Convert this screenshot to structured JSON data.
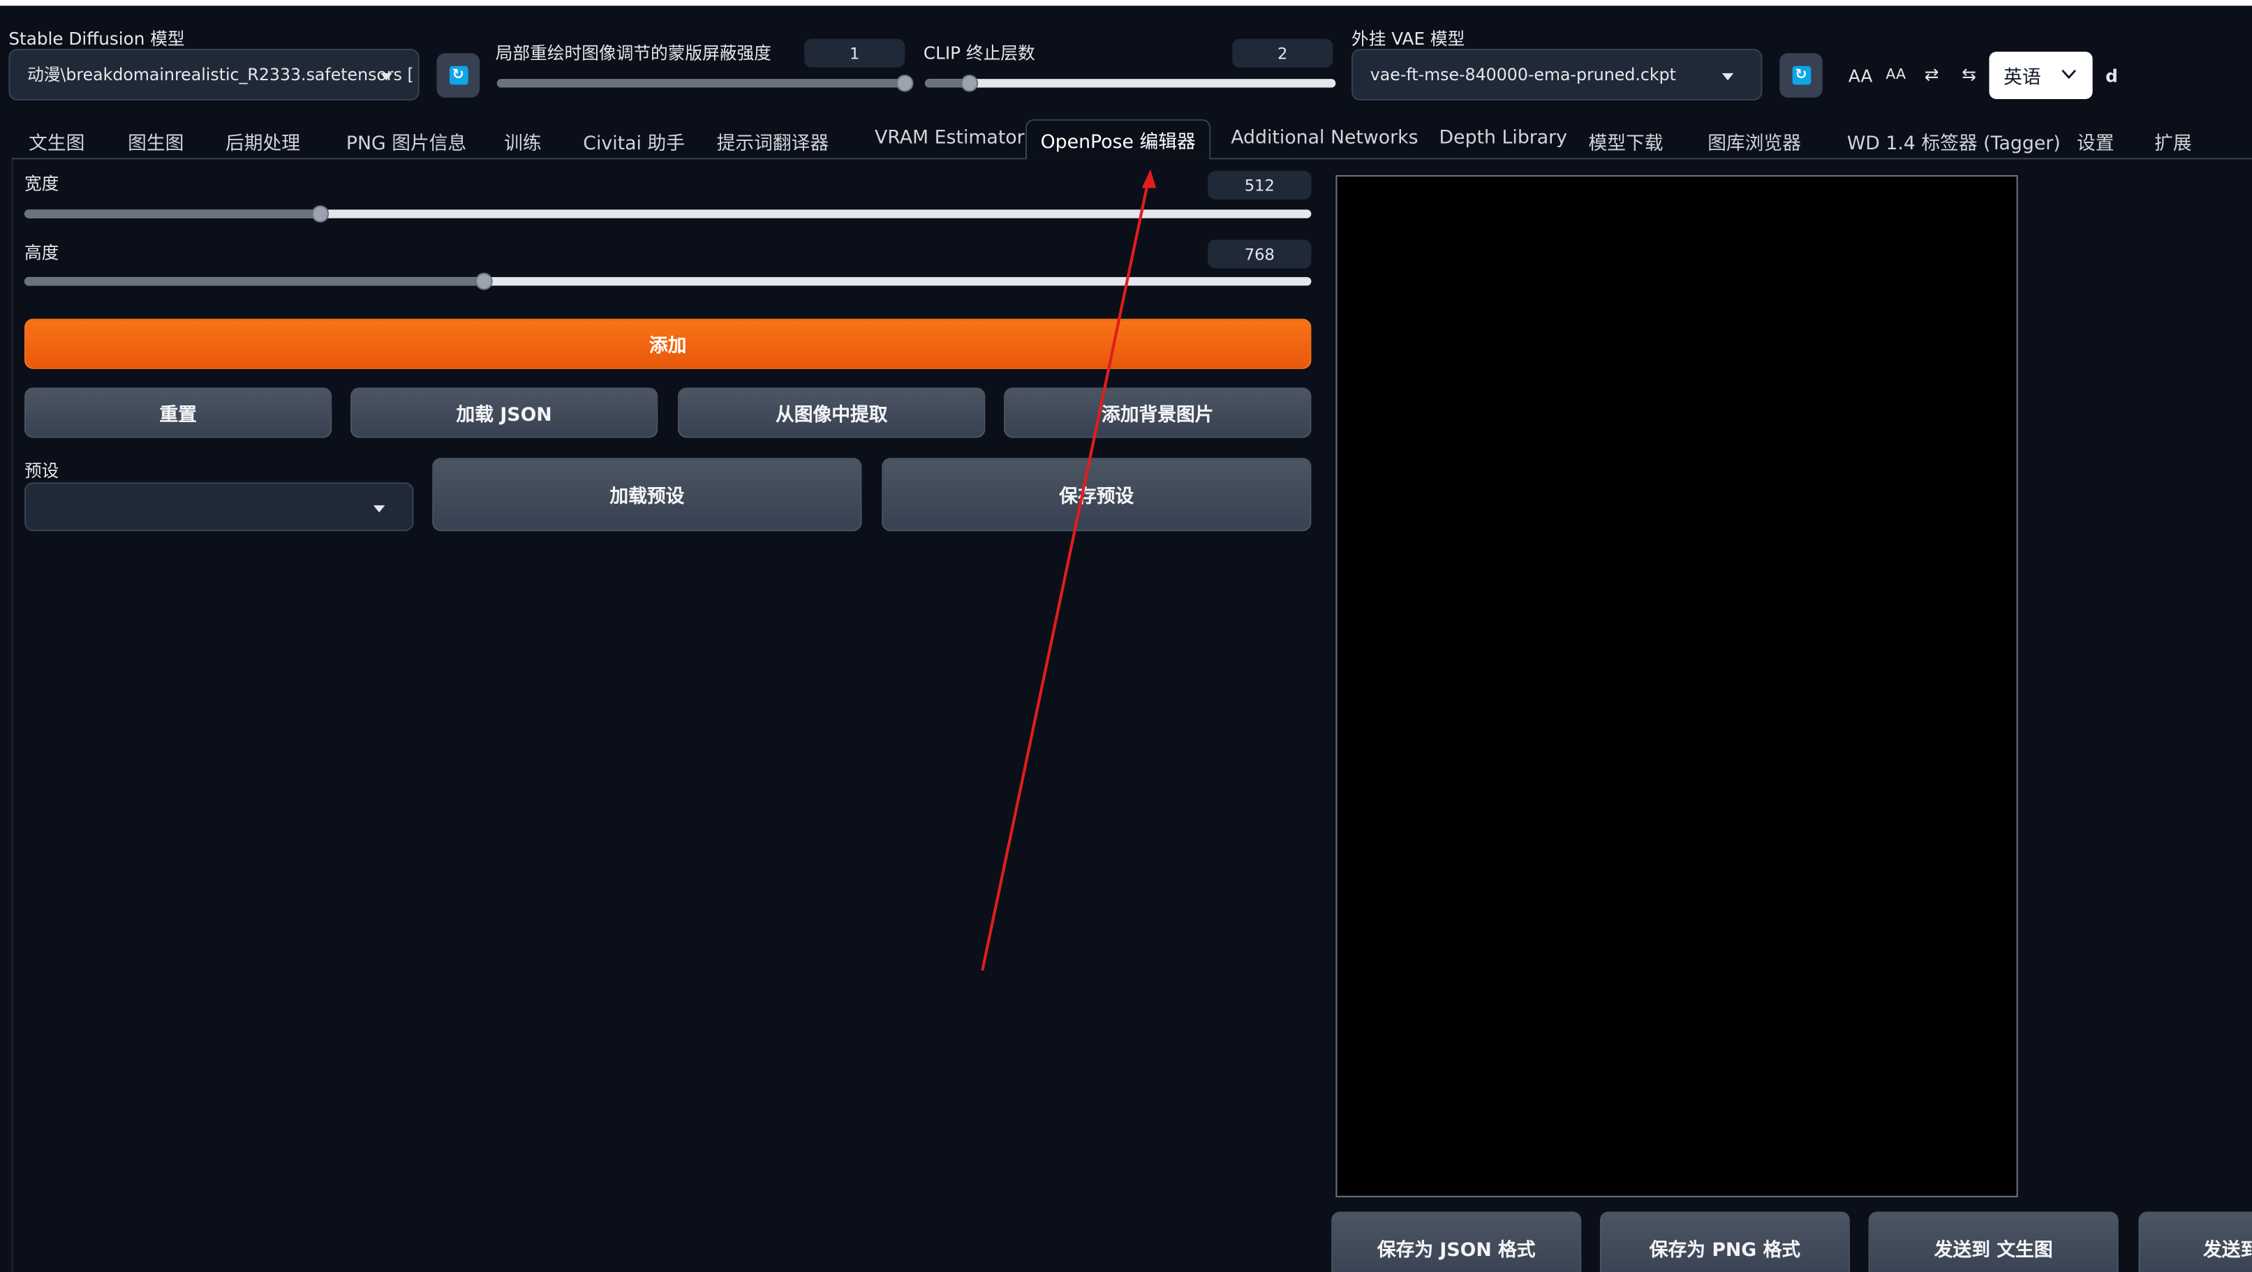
{
  "header": {
    "sd_model": {
      "label": "Stable Diffusion 模型",
      "value": "动漫\\breakdomainrealistic_R2333.safetensors ["
    },
    "mask_strength": {
      "label": "局部重绘时图像调节的蒙版屏蔽强度",
      "value": "1",
      "fraction": 1.0
    },
    "clip_skip": {
      "label": "CLIP 终止层数",
      "value": "2",
      "fraction": 0.11
    },
    "vae": {
      "label": "外挂 VAE 模型",
      "value": "vae-ft-mse-840000-ema-pruned.ckpt"
    },
    "tools": {
      "font_large": "AA",
      "font_small": "AA",
      "swap": "⇄",
      "layout": "⇆"
    },
    "language": "英语",
    "trailing_char": "d"
  },
  "tabs": [
    "文生图",
    "图生图",
    "后期处理",
    "PNG 图片信息",
    "训练",
    "Civitai 助手",
    "提示词翻译器",
    "VRAM Estimator",
    "OpenPose 编辑器",
    "Additional Networks",
    "Depth Library",
    "模型下载",
    "图库浏览器",
    "WD 1.4 标签器 (Tagger)",
    "设置",
    "扩展"
  ],
  "active_tab": "OpenPose 编辑器",
  "openpose": {
    "width": {
      "label": "宽度",
      "value": "512",
      "fraction": 0.23
    },
    "height": {
      "label": "高度",
      "value": "768",
      "fraction": 0.357
    },
    "add_label": "添加",
    "reset_label": "重置",
    "load_json_label": "加载 JSON",
    "extract_label": "从图像中提取",
    "add_bg_label": "添加背景图片",
    "preset_label": "预设",
    "preset_value": "",
    "load_preset_label": "加载预设",
    "save_preset_label": "保存预设",
    "save_json_label": "保存为 JSON 格式",
    "save_png_label": "保存为 PNG 格式",
    "send_txt2img_label": "发送到 文生图",
    "send_more_label": "发送到"
  },
  "colors": {
    "accent": "#f97316",
    "annotation_arrow": "#e11d1d",
    "refresh_icon": "#0ea5e9",
    "background": "#0b0f19"
  },
  "icons": [
    "refresh-icon",
    "chevron-down-icon",
    "swap-icon",
    "layout-icon",
    "arrow-annotation"
  ]
}
